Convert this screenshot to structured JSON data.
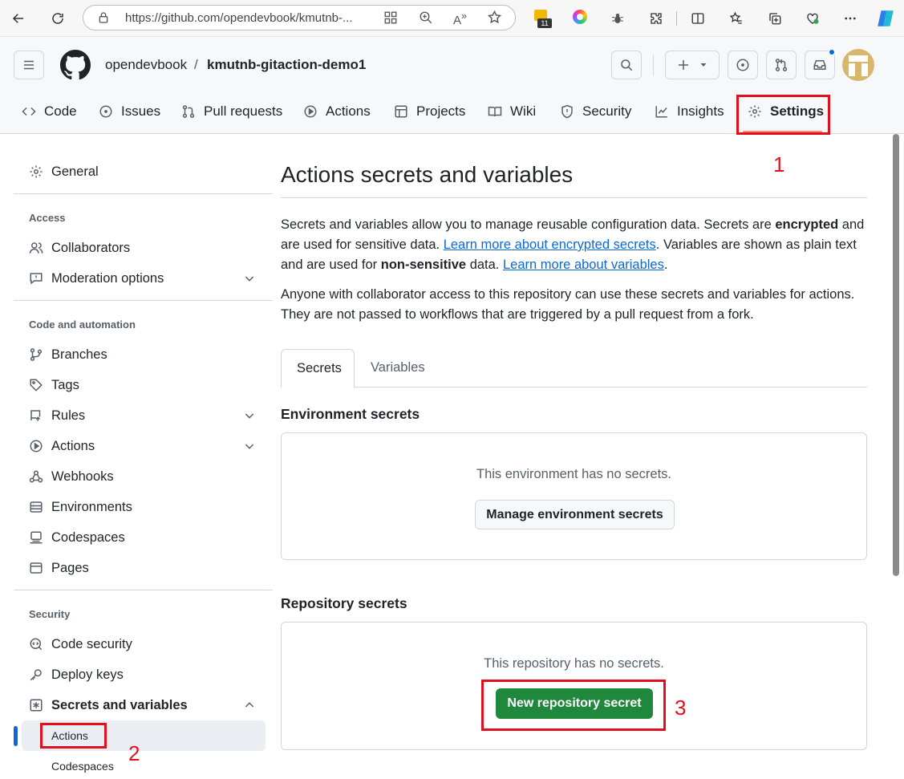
{
  "browser": {
    "url": "https://github.com/opendevbook/kmutnb-...",
    "badge_count": "11"
  },
  "header": {
    "owner": "opendevbook",
    "separator": "/",
    "repo": "kmutnb-gitaction-demo1"
  },
  "tabs": [
    {
      "label": "Code",
      "icon": "code-icon"
    },
    {
      "label": "Issues",
      "icon": "issue-icon"
    },
    {
      "label": "Pull requests",
      "icon": "pull-request-icon"
    },
    {
      "label": "Actions",
      "icon": "play-icon"
    },
    {
      "label": "Projects",
      "icon": "table-icon"
    },
    {
      "label": "Wiki",
      "icon": "book-icon"
    },
    {
      "label": "Security",
      "icon": "shield-icon"
    },
    {
      "label": "Insights",
      "icon": "graph-icon"
    },
    {
      "label": "Settings",
      "icon": "gear-icon"
    }
  ],
  "sidebar": {
    "general": "General",
    "access_heading": "Access",
    "collaborators": "Collaborators",
    "moderation": "Moderation options",
    "code_heading": "Code and automation",
    "branches": "Branches",
    "tags": "Tags",
    "rules": "Rules",
    "actions": "Actions",
    "webhooks": "Webhooks",
    "environments": "Environments",
    "codespaces": "Codespaces",
    "pages": "Pages",
    "security_heading": "Security",
    "code_security": "Code security",
    "deploy_keys": "Deploy keys",
    "secrets_vars": "Secrets and variables",
    "sub_actions": "Actions",
    "sub_codespaces": "Codespaces"
  },
  "main": {
    "title": "Actions secrets and variables",
    "p1_a": "Secrets and variables allow you to manage reusable configuration data. Secrets are ",
    "p1_b": "encrypted",
    "p1_c": " and are used for sensitive data. ",
    "p1_link1": "Learn more about encrypted secrets",
    "p1_d": ". Variables are shown as plain text and are used for ",
    "p1_e": "non-sensitive",
    "p1_f": " data. ",
    "p1_link2": "Learn more about variables",
    "p1_g": ".",
    "p2": "Anyone with collaborator access to this repository can use these secrets and variables for actions. They are not passed to workflows that are triggered by a pull request from a fork.",
    "tab_secrets": "Secrets",
    "tab_variables": "Variables",
    "env_heading": "Environment secrets",
    "env_empty": "This environment has no secrets.",
    "env_button": "Manage environment secrets",
    "repo_heading": "Repository secrets",
    "repo_empty": "This repository has no secrets.",
    "repo_button": "New repository secret"
  },
  "annotations": {
    "n1": "1",
    "n2": "2",
    "n3": "3"
  },
  "colors": {
    "accent_red": "#e1101e",
    "primary_green": "#1f883d",
    "link_blue": "#0969da"
  }
}
